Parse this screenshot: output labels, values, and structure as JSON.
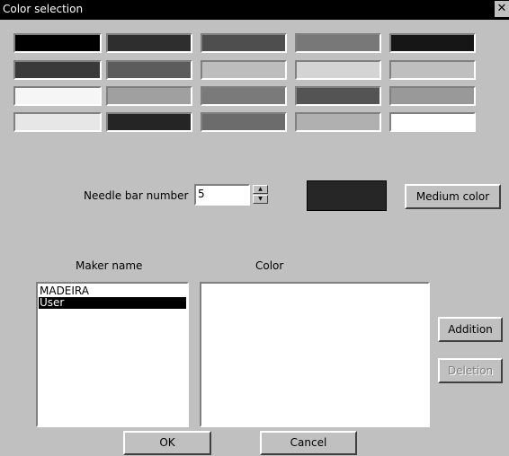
{
  "window": {
    "title": "Color selection",
    "close_glyph": "✕"
  },
  "palette": [
    [
      "#000000",
      "#2e2e2e",
      "#4e4e4e",
      "#787878",
      "#161616"
    ],
    [
      "#3a3a3a",
      "#5c5c5c",
      "#bdbdbd",
      "#d4d4d4",
      "#bfbfbf"
    ],
    [
      "#f6f6f6",
      "#a0a0a0",
      "#7a7a7a",
      "#545454",
      "#999999"
    ],
    [
      "#e7e7e7",
      "#252525",
      "#6c6c6c",
      "#b0b0b0",
      "#ffffff"
    ]
  ],
  "needle": {
    "label": "Needle bar number",
    "value": "5",
    "preview_color": "#262626"
  },
  "medium_color_label": "Medium color",
  "maker": {
    "header": "Maker name",
    "items": [
      {
        "label": "MADEIRA",
        "selected": false
      },
      {
        "label": "User",
        "selected": true
      }
    ]
  },
  "color_list": {
    "header": "Color"
  },
  "buttons": {
    "addition": "Addition",
    "deletion": "Deletion",
    "ok": "OK",
    "cancel": "Cancel"
  }
}
